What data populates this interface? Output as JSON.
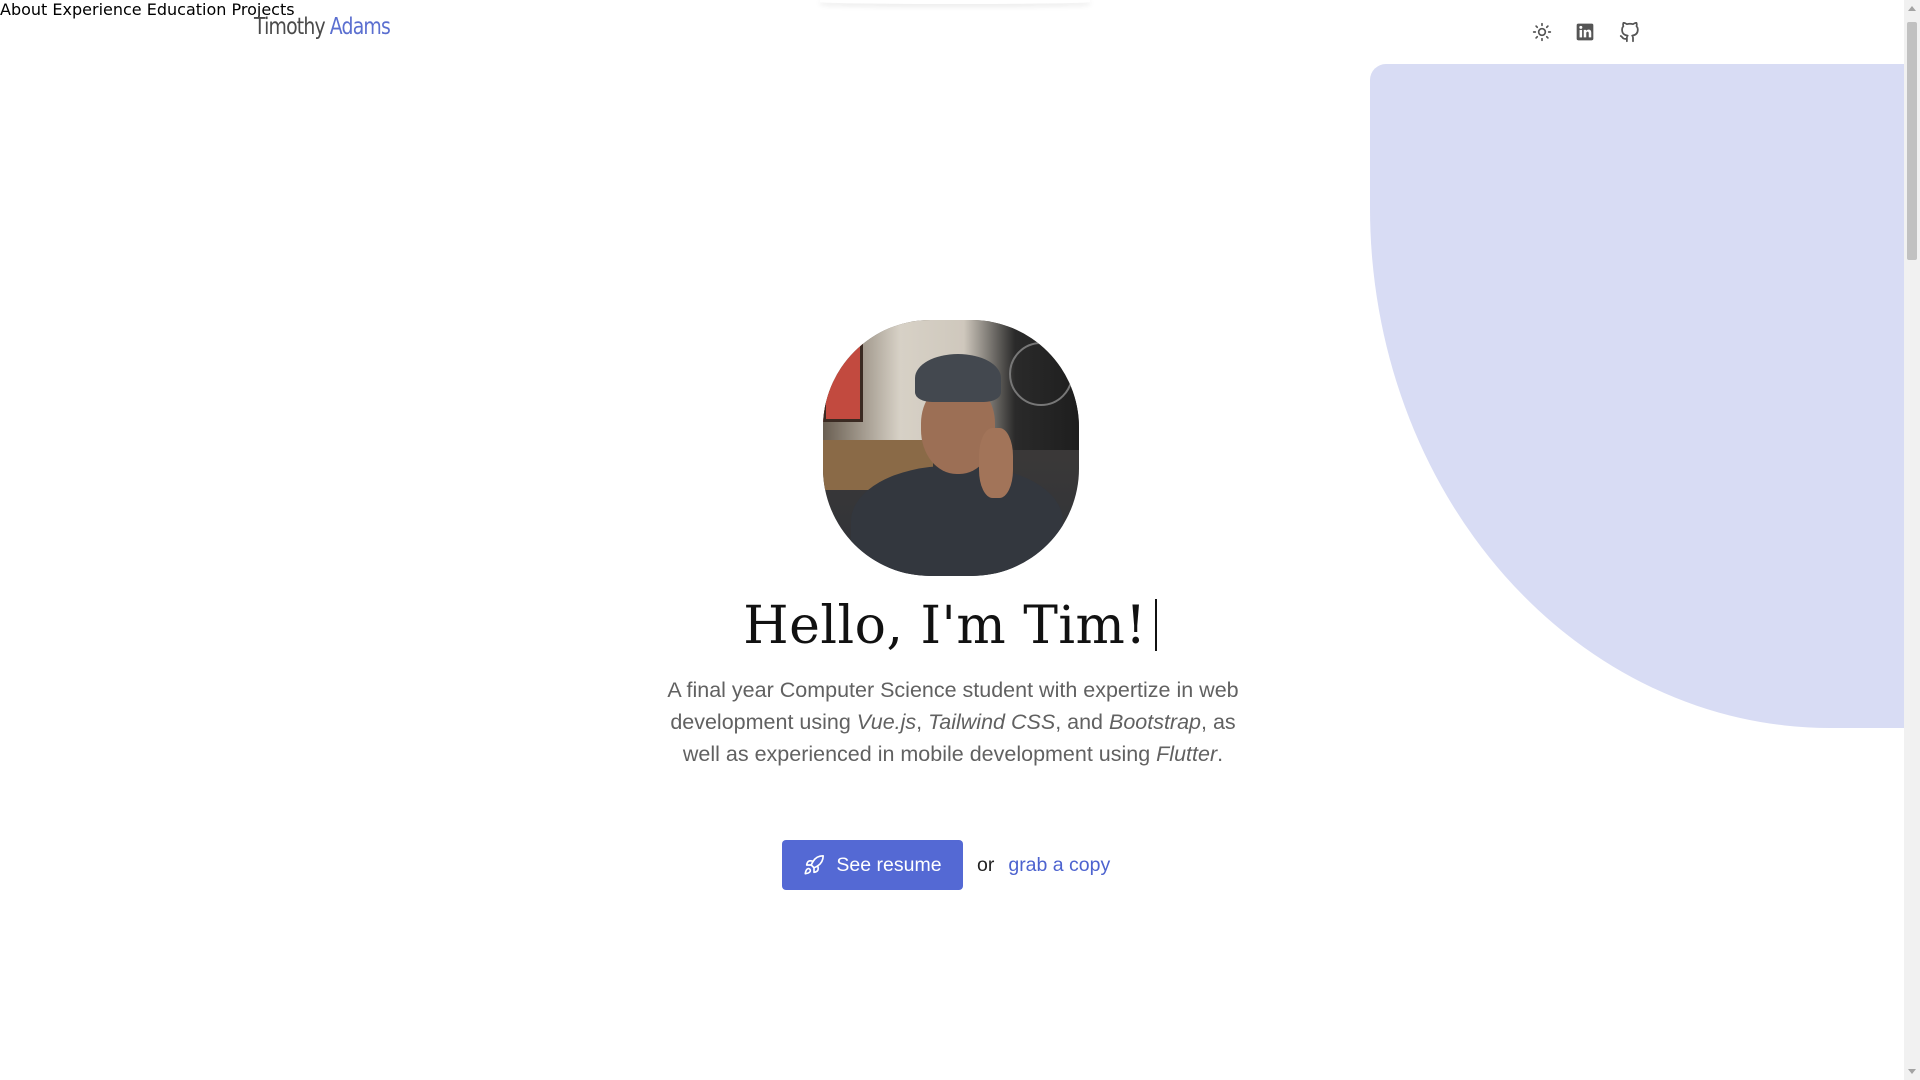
{
  "header": {
    "logo_first": "Timothy",
    "logo_last": "Adams",
    "nav": [
      "About",
      "Experience",
      "Education",
      "Projects"
    ],
    "icons": [
      "sun-icon",
      "linkedin-icon",
      "github-icon"
    ]
  },
  "hero": {
    "title": "Hello, I'm Tim!",
    "description": {
      "p1": "A final year Computer Science student with expertize in web development using ",
      "tech1": "Vue.js",
      "sep1": ", ",
      "tech2": "Tailwind CSS",
      "sep2": ", and ",
      "tech3": "Bootstrap",
      "p2": ", as well as experienced in mobile development using ",
      "tech4": "Flutter",
      "p3": "."
    },
    "resume_button": "See resume",
    "or_text": "or",
    "grab_link": "grab a copy"
  },
  "colors": {
    "accent": "#5469d4",
    "blob": "#d8dcf4",
    "link": "#4d63cf"
  }
}
